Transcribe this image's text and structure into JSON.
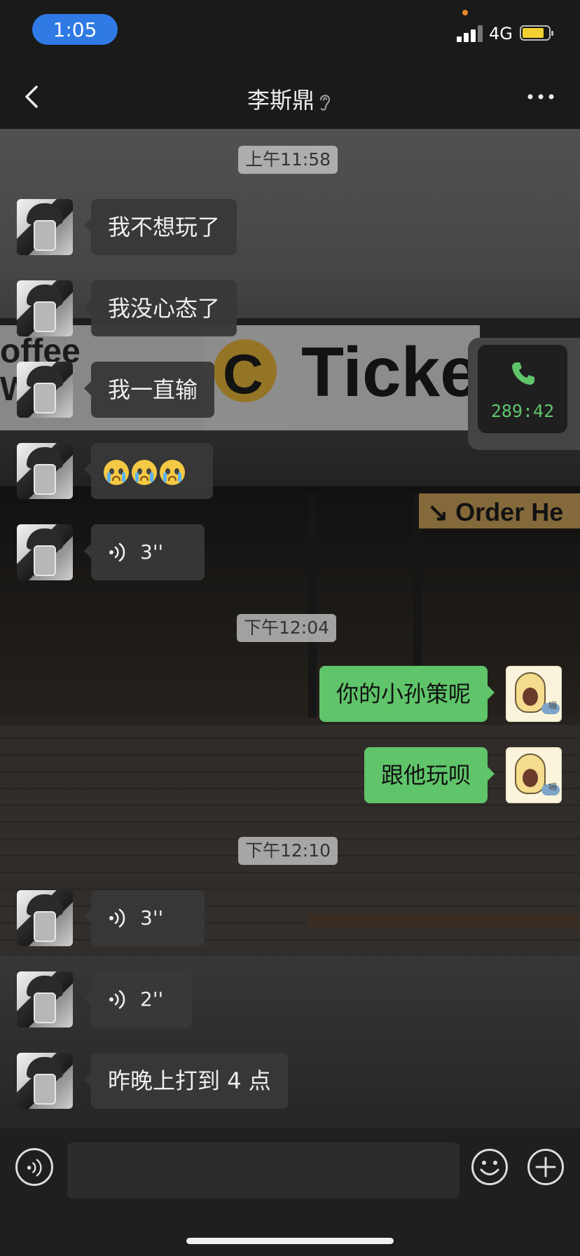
{
  "status_bar": {
    "time": "1:05",
    "network": "4G"
  },
  "nav": {
    "title": "李斯鼎"
  },
  "timestamps": [
    "上午11:58",
    "下午12:04",
    "下午12:10"
  ],
  "messages": [
    {
      "side": "in",
      "type": "text",
      "text": "我不想玩了"
    },
    {
      "side": "in",
      "type": "text",
      "text": "我没心态了"
    },
    {
      "side": "in",
      "type": "text",
      "text": "我一直输"
    },
    {
      "side": "in",
      "type": "emoji",
      "emojis": [
        "crying-face",
        "crying-face",
        "crying-face"
      ]
    },
    {
      "side": "in",
      "type": "voice",
      "duration": "3''"
    },
    {
      "side": "out",
      "type": "text",
      "text": "你的小孙策呢"
    },
    {
      "side": "out",
      "type": "text",
      "text": "跟他玩呗"
    },
    {
      "side": "in",
      "type": "voice",
      "duration": "3''"
    },
    {
      "side": "in",
      "type": "voice",
      "duration": "2''"
    },
    {
      "side": "in",
      "type": "text",
      "text": "昨晚上打到 4 点"
    }
  ],
  "call_widget": {
    "timer": "289:42",
    "icon": "phone-icon"
  },
  "my_avatar": {
    "char": "嗝"
  },
  "input": {
    "placeholder": "",
    "value": ""
  },
  "icons": [
    "back-icon",
    "ear-icon",
    "more-icon",
    "voice-icon",
    "emoji-face-icon",
    "plus-icon"
  ],
  "colors": {
    "outgoing_bubble": "#5fc46a",
    "incoming_bubble": "#383838",
    "time_pill": "#2f7ae5",
    "call_timer": "#5fc46a"
  }
}
